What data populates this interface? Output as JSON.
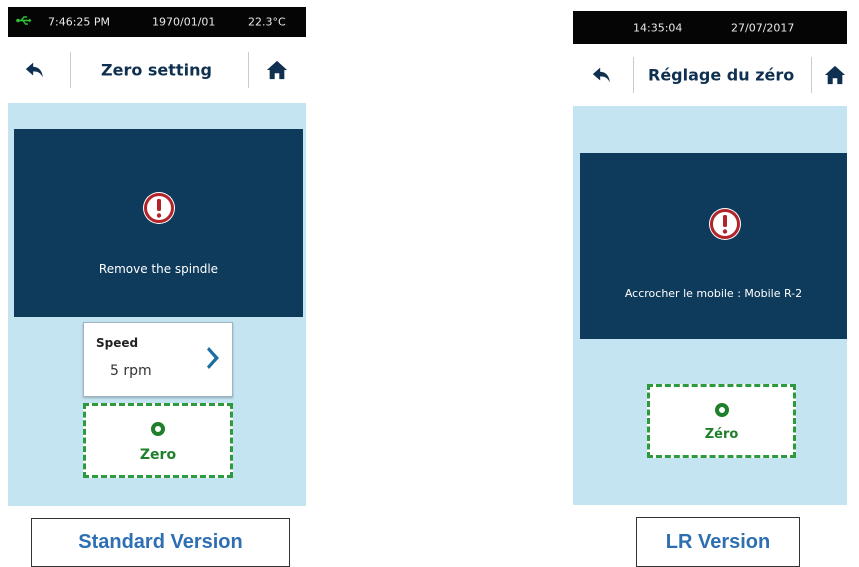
{
  "standard_screen": {
    "status": {
      "usb_icon": "usb-icon",
      "time": "7:46:25 PM",
      "date": "1970/01/01",
      "temperature": "22.3°C"
    },
    "nav": {
      "title": "Zero setting",
      "back_icon": "back-arrow-icon",
      "home_icon": "home-icon"
    },
    "alert": {
      "icon": "warning-icon",
      "message": "Remove the spindle"
    },
    "speed": {
      "label": "Speed",
      "value": "5 rpm",
      "chevron_icon": "chevron-right-icon"
    },
    "zero_button": {
      "label": "Zero",
      "icon": "ring-icon"
    }
  },
  "lr_screen": {
    "status": {
      "time": "14:35:04",
      "date": "27/07/2017"
    },
    "nav": {
      "title": "Réglage du zéro",
      "back_icon": "back-arrow-icon",
      "home_icon": "home-icon"
    },
    "alert": {
      "icon": "warning-icon",
      "message": "Accrocher le mobile : Mobile R-2"
    },
    "zero_button": {
      "label": "Zéro",
      "icon": "ring-icon"
    }
  },
  "captions": {
    "standard": "Standard Version",
    "lr": "LR Version"
  },
  "colors": {
    "screen_bg": "#c4e4f2",
    "alert_bg": "#0e3a5c",
    "title_color": "#0f3050",
    "zero_green": "#1f7f2a",
    "warning_red": "#b0242a",
    "caption_blue": "#2e6fb2"
  }
}
